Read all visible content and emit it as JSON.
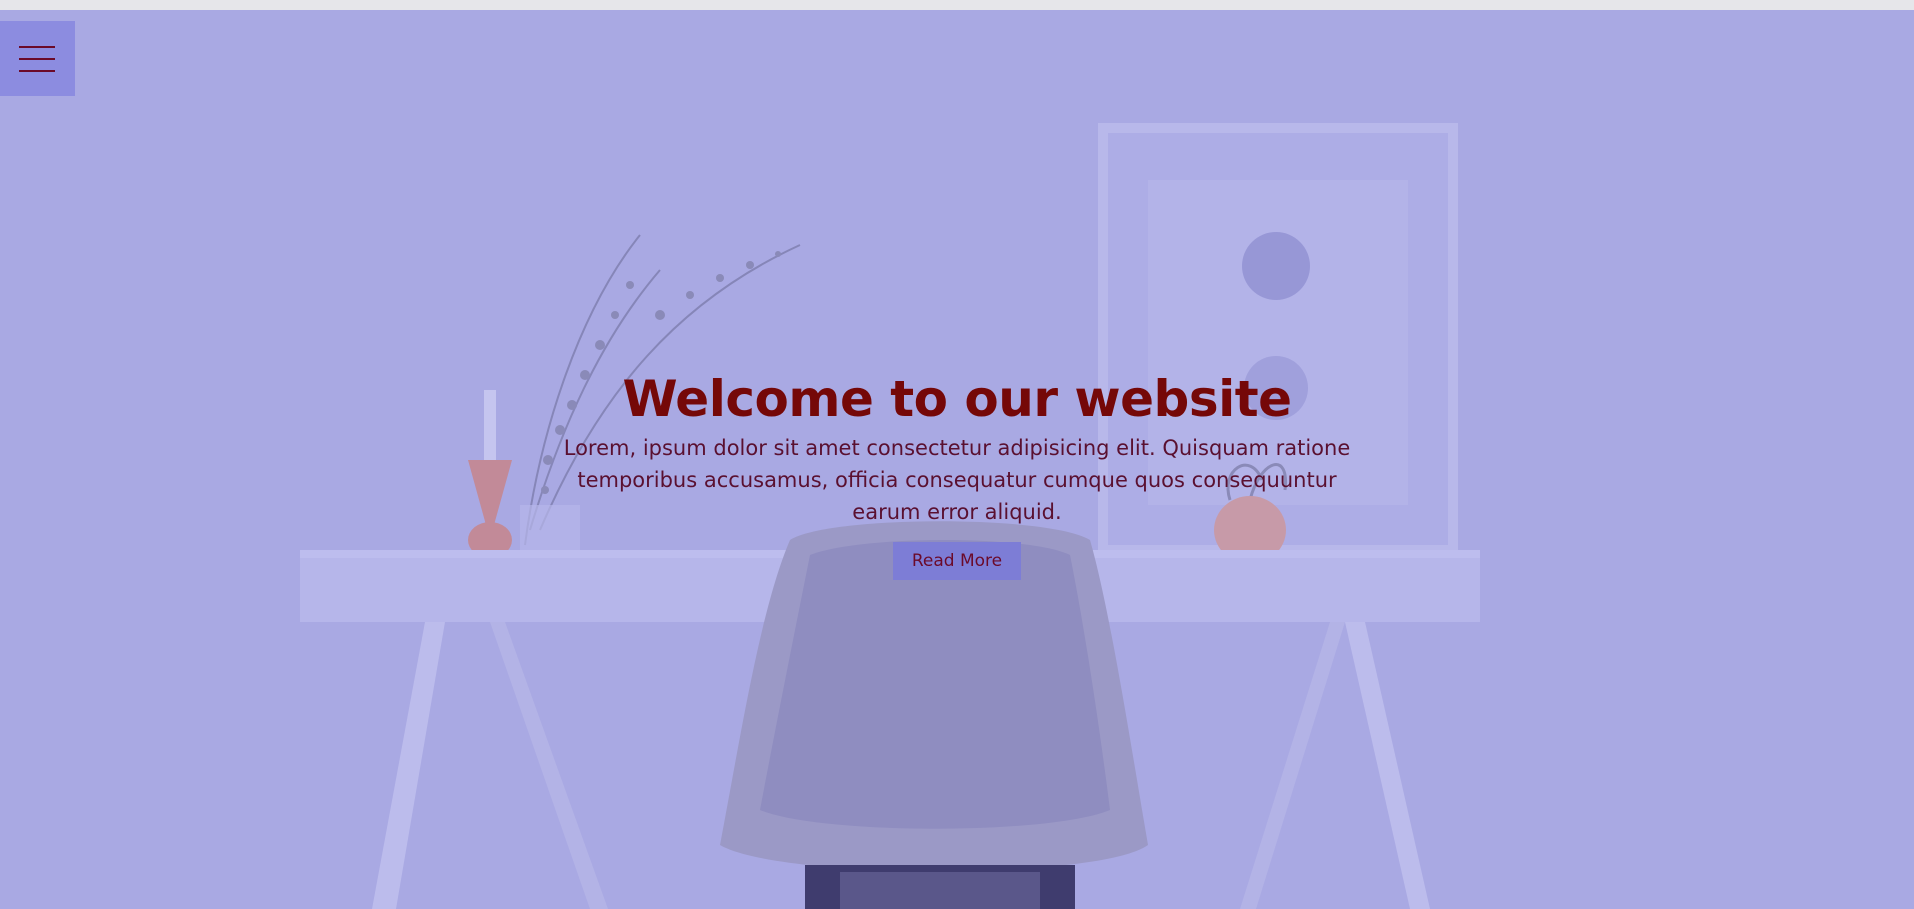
{
  "hero": {
    "title": "Welcome to our website",
    "description": "Lorem, ipsum dolor sit amet consectetur adipisicing elit. Quisquam ratione temporibus accusamus, officia consequatur cumque quos consequuntur earum error aliquid.",
    "button_label": "Read More"
  },
  "menu": {
    "icon": "hamburger-icon"
  },
  "colors": {
    "overlay": "#a9a9e3",
    "menu_bg": "#8c8ce0",
    "button_bg": "#7d7dd6",
    "title": "#750808",
    "text": "#5a1030"
  }
}
